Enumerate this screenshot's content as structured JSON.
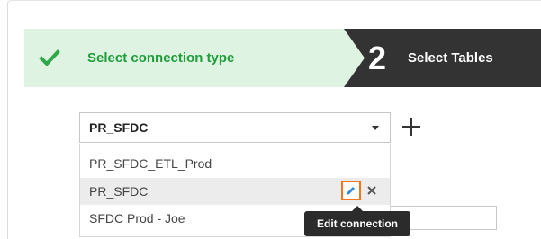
{
  "stepper": {
    "step1": {
      "label": "Select connection type",
      "status": "complete",
      "icon": "check-icon",
      "color": "#1f9e3a"
    },
    "step2": {
      "number": "2",
      "label": "Select Tables",
      "status": "active",
      "color": "#333333"
    }
  },
  "connection_select": {
    "value": "PR_SFDC",
    "options": [
      "PR_SFDC_ETL_Prod",
      "PR_SFDC",
      "SFDC Prod - Joe"
    ]
  },
  "add_button": {
    "icon": "plus-icon"
  },
  "option_actions": {
    "edit_icon": "pencil-icon",
    "remove_icon": "close-icon",
    "highlight_color": "#f5761a"
  },
  "tooltip": {
    "text": "Edit connection"
  }
}
